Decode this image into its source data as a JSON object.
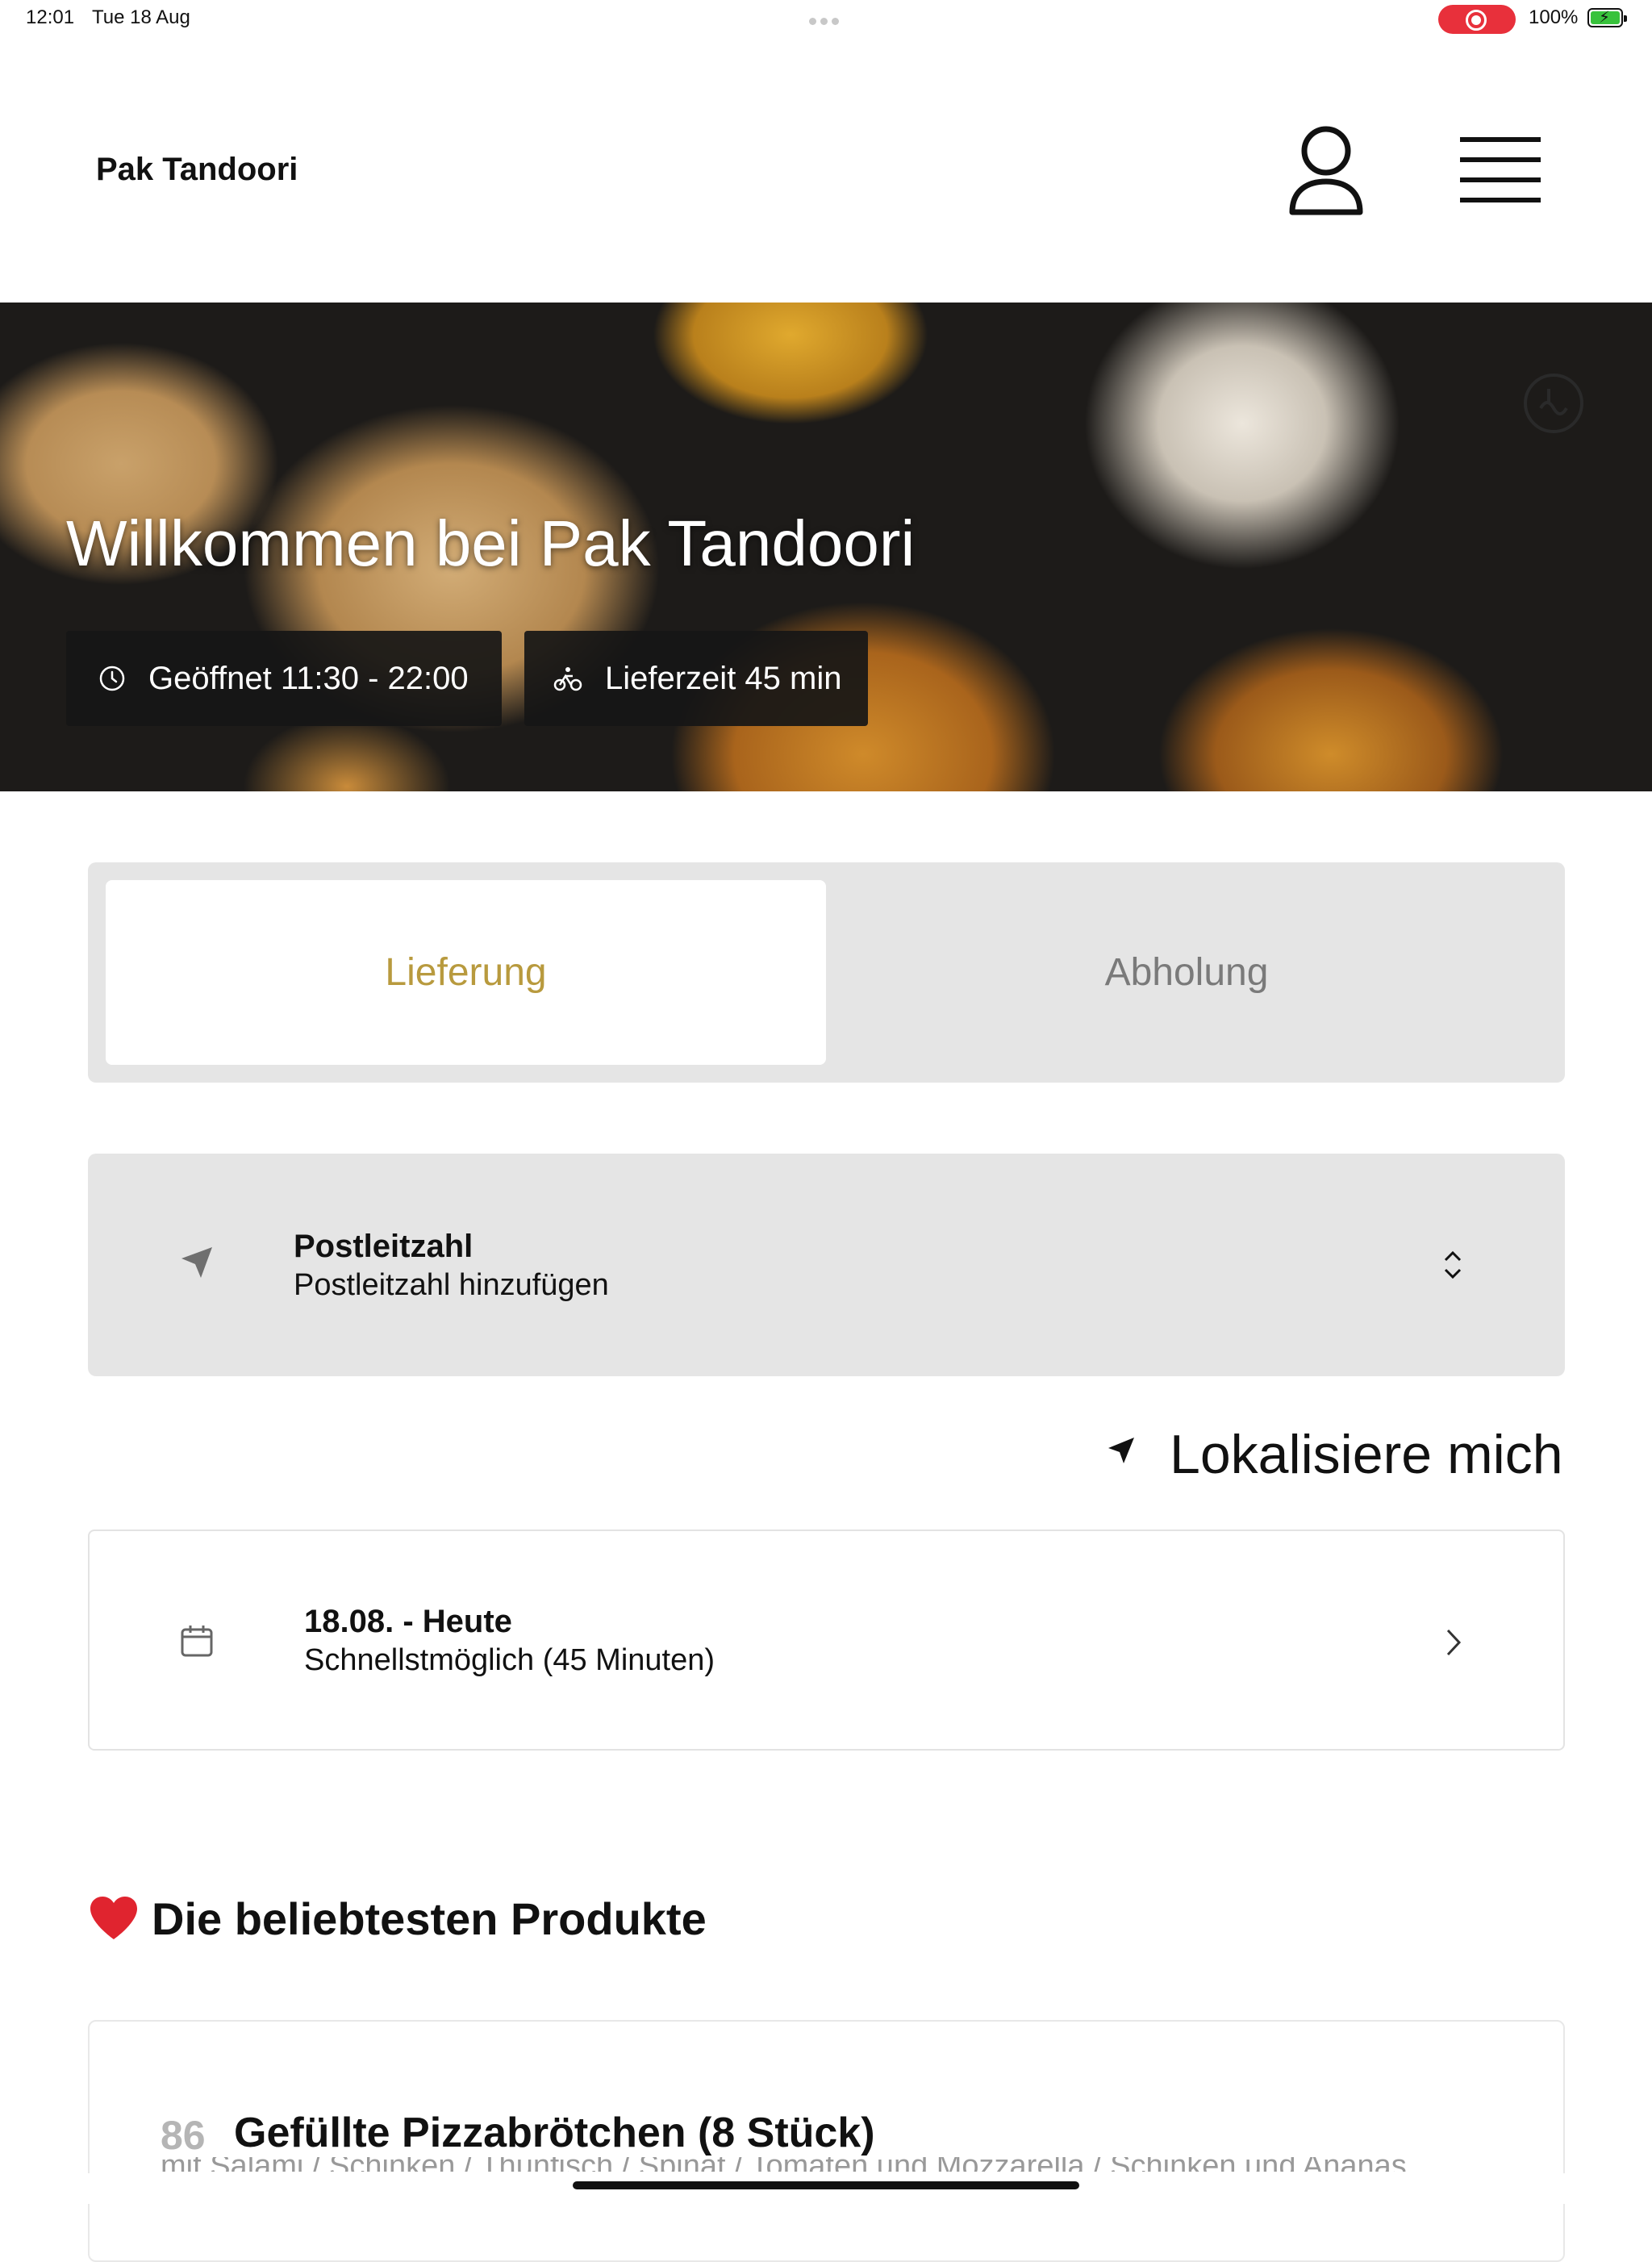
{
  "status_bar": {
    "time": "12:01",
    "date": "Tue 18 Aug",
    "battery": "100%",
    "recording_color": "#e8303b",
    "battery_color": "#38c23c"
  },
  "header": {
    "brand": "Pak Tandoori",
    "icons": [
      "user-icon",
      "menu-icon"
    ]
  },
  "hero": {
    "title": "Willkommen bei Pak Tandoori",
    "opening_hours": "Geöffnet 11:30 - 22:00",
    "delivery_time": "Lieferzeit 45 min",
    "icons": [
      "clock-icon",
      "bicycle-icon",
      "halal-icon"
    ]
  },
  "order_mode": {
    "options": [
      "Lieferung",
      "Abholung"
    ],
    "selected": "Lieferung",
    "accent_color": "#b89a3e"
  },
  "postcode": {
    "title": "Postleitzahl",
    "subtitle": "Postleitzahl hinzufügen"
  },
  "locate": {
    "label": "Lokalisiere mich"
  },
  "schedule": {
    "title": "18.08. - Heute",
    "subtitle": "Schnellstmöglich (45 Minuten)"
  },
  "products": {
    "heading": "Die beliebtesten Produkte",
    "items": [
      {
        "number": "86",
        "name": "Gefüllte Pizzabrötchen (8 Stück)",
        "description": "mit Salami / Schinken / Thunfisch / Spinat / Tomaten und Mozzarella / Schinken und Ananas"
      }
    ]
  }
}
